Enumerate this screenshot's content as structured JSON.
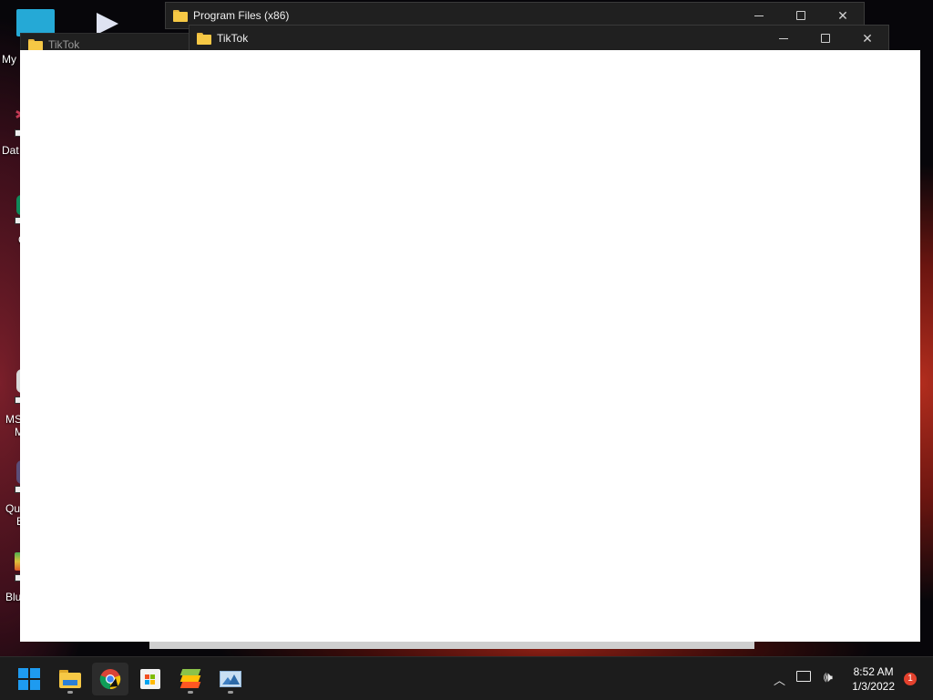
{
  "desktop": {
    "icons": [
      {
        "label": "My",
        "icon": "my-computer-icon"
      },
      {
        "label": "Dat",
        "icon": "data-app-icon"
      },
      {
        "label": "C",
        "icon": "app-icon"
      },
      {
        "label": "MS",
        "icon": "ms-app-icon"
      },
      {
        "label": "M",
        "icon": "app-icon"
      },
      {
        "label": "Qu",
        "icon": "app-icon"
      },
      {
        "label": "E",
        "icon": "app-icon"
      },
      {
        "label": "Blu",
        "icon": "bluestacks-icon"
      }
    ]
  },
  "windows": {
    "back": {
      "title": "Program Files (x86)"
    },
    "middle": {
      "title": "TikTok"
    },
    "front": {
      "title": "TikTok"
    }
  },
  "taskbar": {
    "apps": [
      {
        "name": "Start",
        "icon": "windows-start-icon"
      },
      {
        "name": "File Explorer",
        "icon": "file-explorer-icon"
      },
      {
        "name": "Google Chrome",
        "icon": "chrome-icon"
      },
      {
        "name": "Microsoft Store",
        "icon": "store-icon"
      },
      {
        "name": "BlueStacks",
        "icon": "bluestacks-icon"
      },
      {
        "name": "Screenshot app",
        "icon": "image-app-icon"
      }
    ],
    "tray": {
      "time": "8:52 AM",
      "date": "1/3/2022",
      "notification_count": "1"
    }
  },
  "colors": {
    "taskbar_bg": "#1c1c1c",
    "window_bg": "#202020",
    "folder": "#f6c845",
    "start_blue": "#1e9bf0",
    "notif_red": "#e3412d"
  }
}
